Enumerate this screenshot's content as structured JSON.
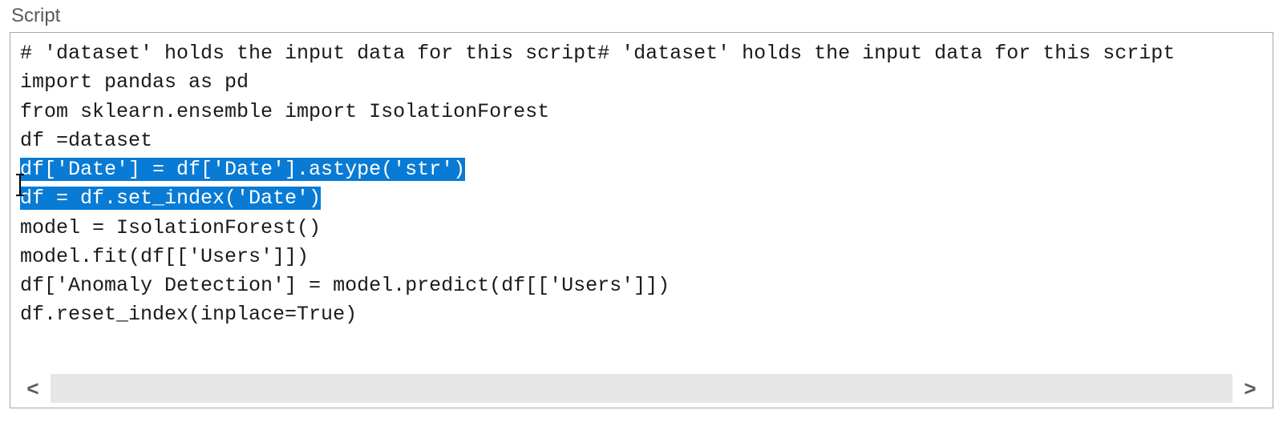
{
  "panel": {
    "title": "Script"
  },
  "code": {
    "lines": [
      {
        "text": "# 'dataset' holds the input data for this script# 'dataset' holds the input data for this script",
        "selected": false
      },
      {
        "text": "import pandas as pd",
        "selected": false
      },
      {
        "text": "from sklearn.ensemble import IsolationForest",
        "selected": false
      },
      {
        "text": "df =dataset",
        "selected": false
      },
      {
        "text": "df['Date'] = df['Date'].astype('str')",
        "selected": true
      },
      {
        "text": "df = df.set_index('Date')",
        "selected": true
      },
      {
        "text": "model = IsolationForest()",
        "selected": false
      },
      {
        "text": "model.fit(df[['Users']])",
        "selected": false
      },
      {
        "text": "df['Anomaly Detection'] = model.predict(df[['Users']])",
        "selected": false
      },
      {
        "text": "df.reset_index(inplace=True)",
        "selected": false
      }
    ]
  },
  "scrollbar": {
    "leftGlyph": "<",
    "rightGlyph": ">"
  }
}
